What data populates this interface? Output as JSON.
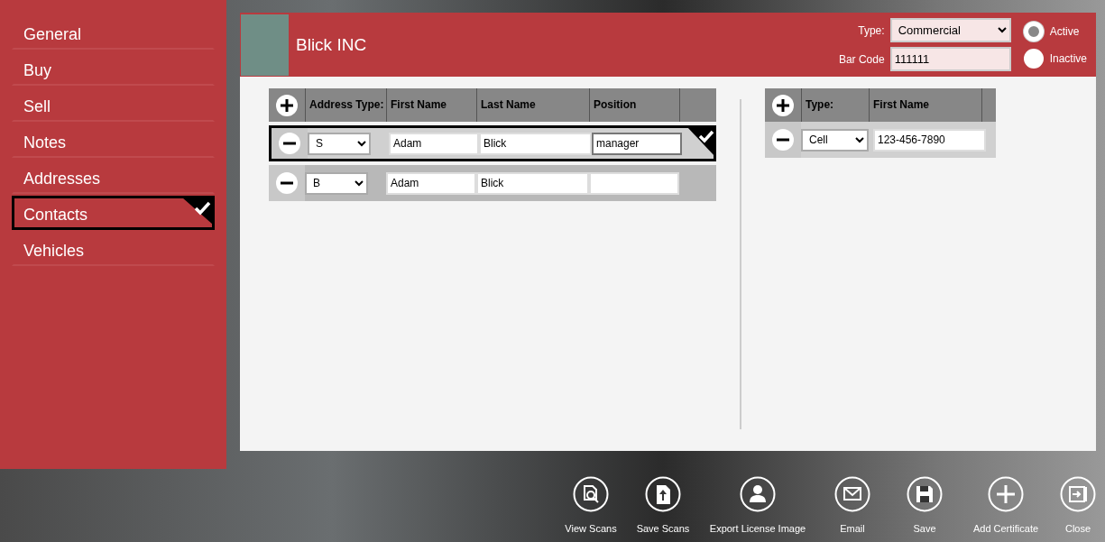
{
  "sidebar": {
    "items": [
      {
        "label": "General",
        "selected": false
      },
      {
        "label": "Buy",
        "selected": false
      },
      {
        "label": "Sell",
        "selected": false
      },
      {
        "label": "Notes",
        "selected": false
      },
      {
        "label": "Addresses",
        "selected": false
      },
      {
        "label": "Contacts",
        "selected": true
      },
      {
        "label": "Vehicles",
        "selected": false
      }
    ]
  },
  "header": {
    "name": "Blick INC",
    "type_label": "Type:",
    "type_value": "Commercial",
    "barcode_label": "Bar Code",
    "barcode_value": "111111",
    "status": [
      {
        "label": "Active",
        "selected": true
      },
      {
        "label": "Inactive",
        "selected": false
      }
    ]
  },
  "contacts_table": {
    "columns": [
      "Address Type:",
      "First Name",
      "Last Name",
      "Position"
    ],
    "rows": [
      {
        "address_type": "S",
        "first_name": "Adam",
        "last_name": "Blick",
        "position": "manager",
        "selected": true
      },
      {
        "address_type": "B",
        "first_name": "Adam",
        "last_name": "Blick",
        "position": "",
        "selected": false
      }
    ]
  },
  "phones_table": {
    "columns": [
      "Type:",
      "First Name"
    ],
    "rows": [
      {
        "type": "Cell",
        "number": "123-456-7890"
      }
    ]
  },
  "toolbar": [
    {
      "kind": "view",
      "label": "View Scans"
    },
    {
      "kind": "savescan",
      "label": "Save Scans"
    },
    {
      "kind": "person",
      "label": "Export License Image"
    },
    {
      "kind": "email",
      "label": "Email"
    },
    {
      "kind": "save",
      "label": "Save"
    },
    {
      "kind": "add",
      "label": "Add Certificate"
    },
    {
      "kind": "close",
      "label": "Close"
    }
  ]
}
